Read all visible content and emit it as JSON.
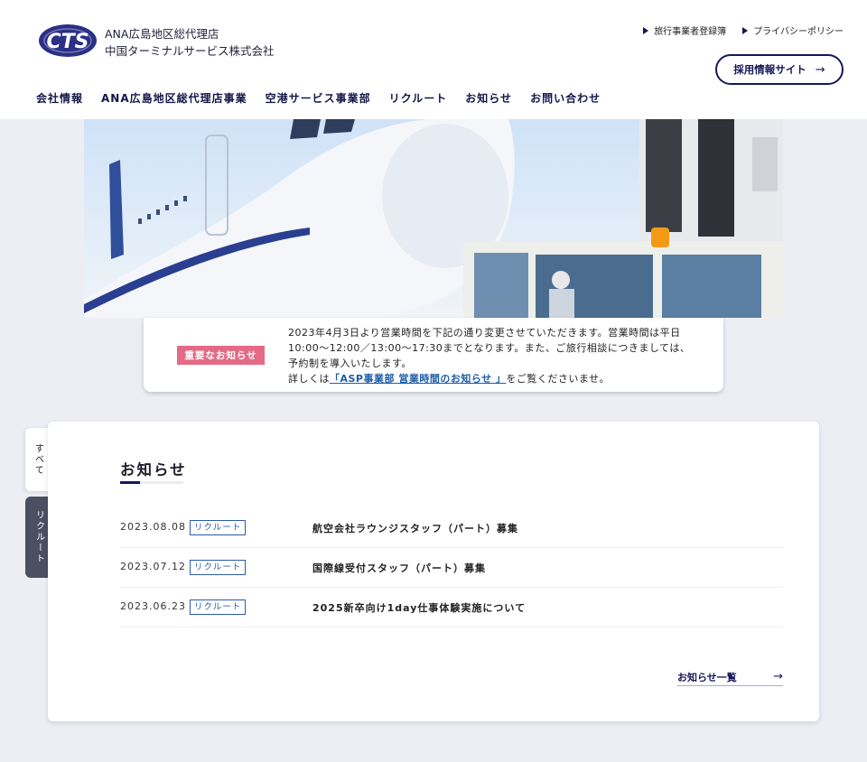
{
  "header": {
    "company_line1": "ANA広島地区総代理店",
    "company_line2": "中国ターミナルサービス株式会社",
    "util_links": [
      "旅行事業者登録簿",
      "プライバシーポリシー"
    ],
    "recruit_button": "採用情報サイト",
    "recruit_arrow": "→",
    "nav": [
      "会社情報",
      "ANA広島地区総代理店事業",
      "空港サービス事業部",
      "リクルート",
      "お知らせ",
      "お問い合わせ"
    ]
  },
  "colors": {
    "navy": "#15185a",
    "notice_badge": "#e46a86",
    "link_blue": "#1e5ea7",
    "page_bg": "#eceef4"
  },
  "notice": {
    "badge": "重要なお知らせ",
    "line1": "2023年4月3日より営業時間を下記の通り変更させていただきます。営業時間は平日",
    "line2": "10:00〜12:00／13:00〜17:30までとなります。また、ご旅行相談につきましては、",
    "line3": "予約制を導入いたします。",
    "line4_prefix": "詳しくは",
    "link": "「ASP事業部 営業時間のお知らせ 」",
    "line4_suffix": "をご覧くださいませ。"
  },
  "side_tabs": [
    "すべて",
    "リクルート"
  ],
  "news": {
    "title": "お知らせ",
    "items": [
      {
        "date": "2023.08.08",
        "tag": "リクルート",
        "text": "航空会社ラウンジスタッフ（パート）募集"
      },
      {
        "date": "2023.07.12",
        "tag": "リクルート",
        "text": "国際線受付スタッフ（パート）募集"
      },
      {
        "date": "2023.06.23",
        "tag": "リクルート",
        "text": "2025新卒向け1day仕事体験実施について"
      }
    ],
    "more": "お知らせ一覧",
    "more_arrow": "→"
  }
}
